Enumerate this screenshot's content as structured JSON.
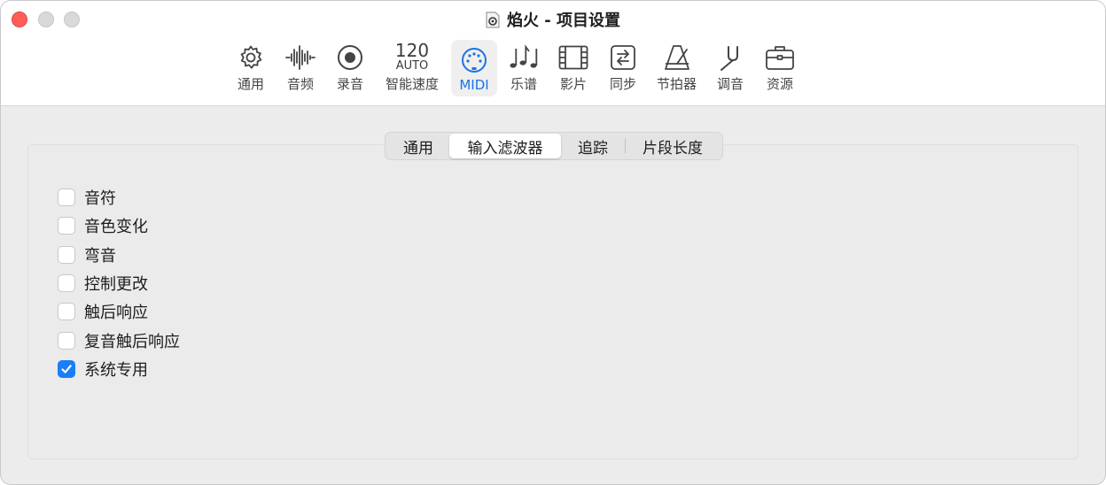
{
  "window": {
    "title": "焰火 - 项目设置",
    "accent_color": "#1a73e8",
    "checkbox_color": "#1a7ef7"
  },
  "toolbar": {
    "items": [
      {
        "label": "通用",
        "icon": "gear-icon"
      },
      {
        "label": "音频",
        "icon": "waveform-icon"
      },
      {
        "label": "录音",
        "icon": "record-icon"
      },
      {
        "label": "智能速度",
        "icon": "tempo-readout",
        "tempo_value": "120",
        "tempo_mode": "AUTO"
      },
      {
        "label": "MIDI",
        "icon": "midi-connector-icon",
        "selected": true
      },
      {
        "label": "乐谱",
        "icon": "music-notes-icon"
      },
      {
        "label": "影片",
        "icon": "film-icon"
      },
      {
        "label": "同步",
        "icon": "sync-icon"
      },
      {
        "label": "节拍器",
        "icon": "metronome-icon"
      },
      {
        "label": "调音",
        "icon": "tuning-fork-icon"
      },
      {
        "label": "资源",
        "icon": "briefcase-icon"
      }
    ]
  },
  "subtabs": {
    "items": [
      "通用",
      "输入滤波器",
      "追踪",
      "片段长度"
    ],
    "active": "输入滤波器"
  },
  "filters": {
    "items": [
      {
        "label": "音符",
        "checked": false
      },
      {
        "label": "音色变化",
        "checked": false
      },
      {
        "label": "弯音",
        "checked": false
      },
      {
        "label": "控制更改",
        "checked": false
      },
      {
        "label": "触后响应",
        "checked": false
      },
      {
        "label": "复音触后响应",
        "checked": false
      },
      {
        "label": "系统专用",
        "checked": true
      }
    ]
  }
}
